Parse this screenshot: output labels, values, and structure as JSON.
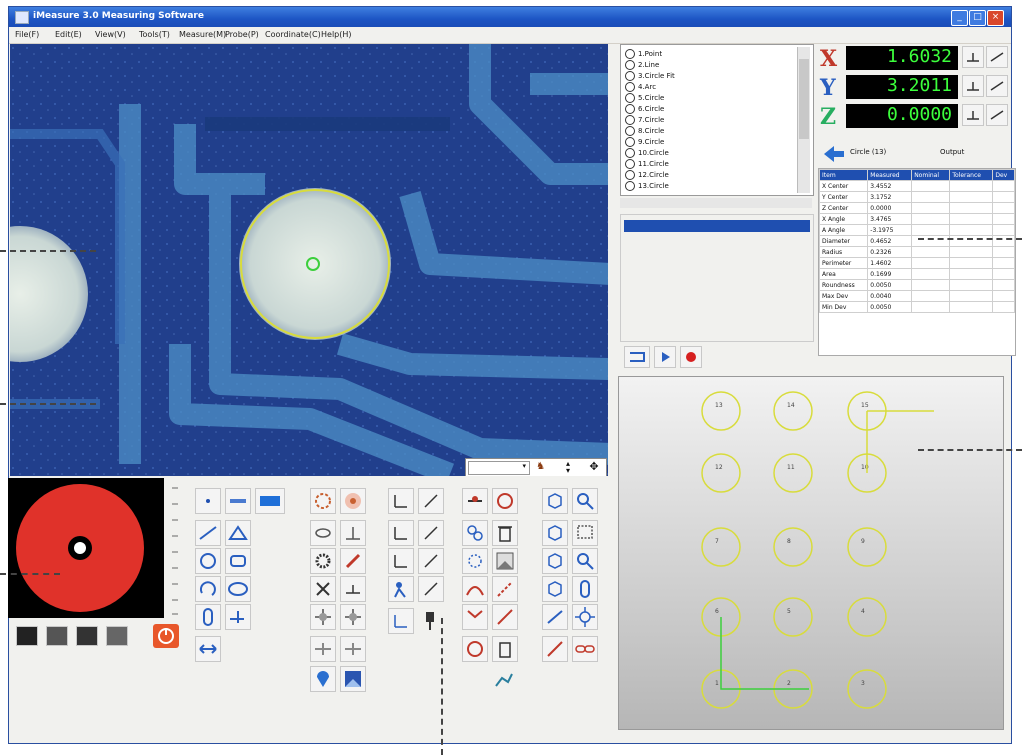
{
  "window": {
    "title": "iMeasure 3.0 Measuring Software"
  },
  "menu": [
    "File(F)",
    "Edit(E)",
    "View(V)",
    "Tools(T)",
    "Measure(M)",
    "Probe(P)",
    "Coordinate(C)",
    "Help(H)"
  ],
  "tree_items": [
    "1.Point",
    "2.Line",
    "3.Circle Fit",
    "4.Arc",
    "5.Circle",
    "6.Circle",
    "7.Circle",
    "8.Circle",
    "9.Circle",
    "10.Circle",
    "11.Circle",
    "12.Circle",
    "13.Circle"
  ],
  "dro": {
    "x_label": "X",
    "x_value": "1.6032",
    "y_label": "Y",
    "y_value": "3.2011",
    "z_label": "Z",
    "z_value": "0.0000"
  },
  "results": {
    "toolbar_left": "Circle (13)",
    "toolbar_right": "Output",
    "headers": [
      "Item",
      "Measured",
      "Nominal",
      "Tolerance",
      "Dev"
    ],
    "rows": [
      [
        "X Center",
        "3.4552"
      ],
      [
        "Y Center",
        "3.1752"
      ],
      [
        "Z Center",
        "0.0000"
      ],
      [
        "X Angle",
        "3.4765"
      ],
      [
        "A Angle",
        "-3.1975"
      ],
      [
        "Diameter",
        "0.4652"
      ],
      [
        "Radius",
        "0.2326"
      ],
      [
        "Perimeter",
        "1.4602"
      ],
      [
        "Area",
        "0.1699"
      ],
      [
        "Roundness",
        "0.0050"
      ],
      [
        "Max Dev",
        "0.0040"
      ],
      [
        "Min Dev",
        "0.0050"
      ]
    ]
  },
  "graphic_labels": [
    "13",
    "14",
    "15",
    "12",
    "11",
    "10",
    "7",
    "8",
    "9",
    "6",
    "5",
    "4",
    "1",
    "2",
    "3"
  ],
  "colors": {
    "accent": "#1d55c4",
    "dro_text": "#3cff3c",
    "profile_red": "#e0322a",
    "highlight": "#d8dc3c"
  }
}
